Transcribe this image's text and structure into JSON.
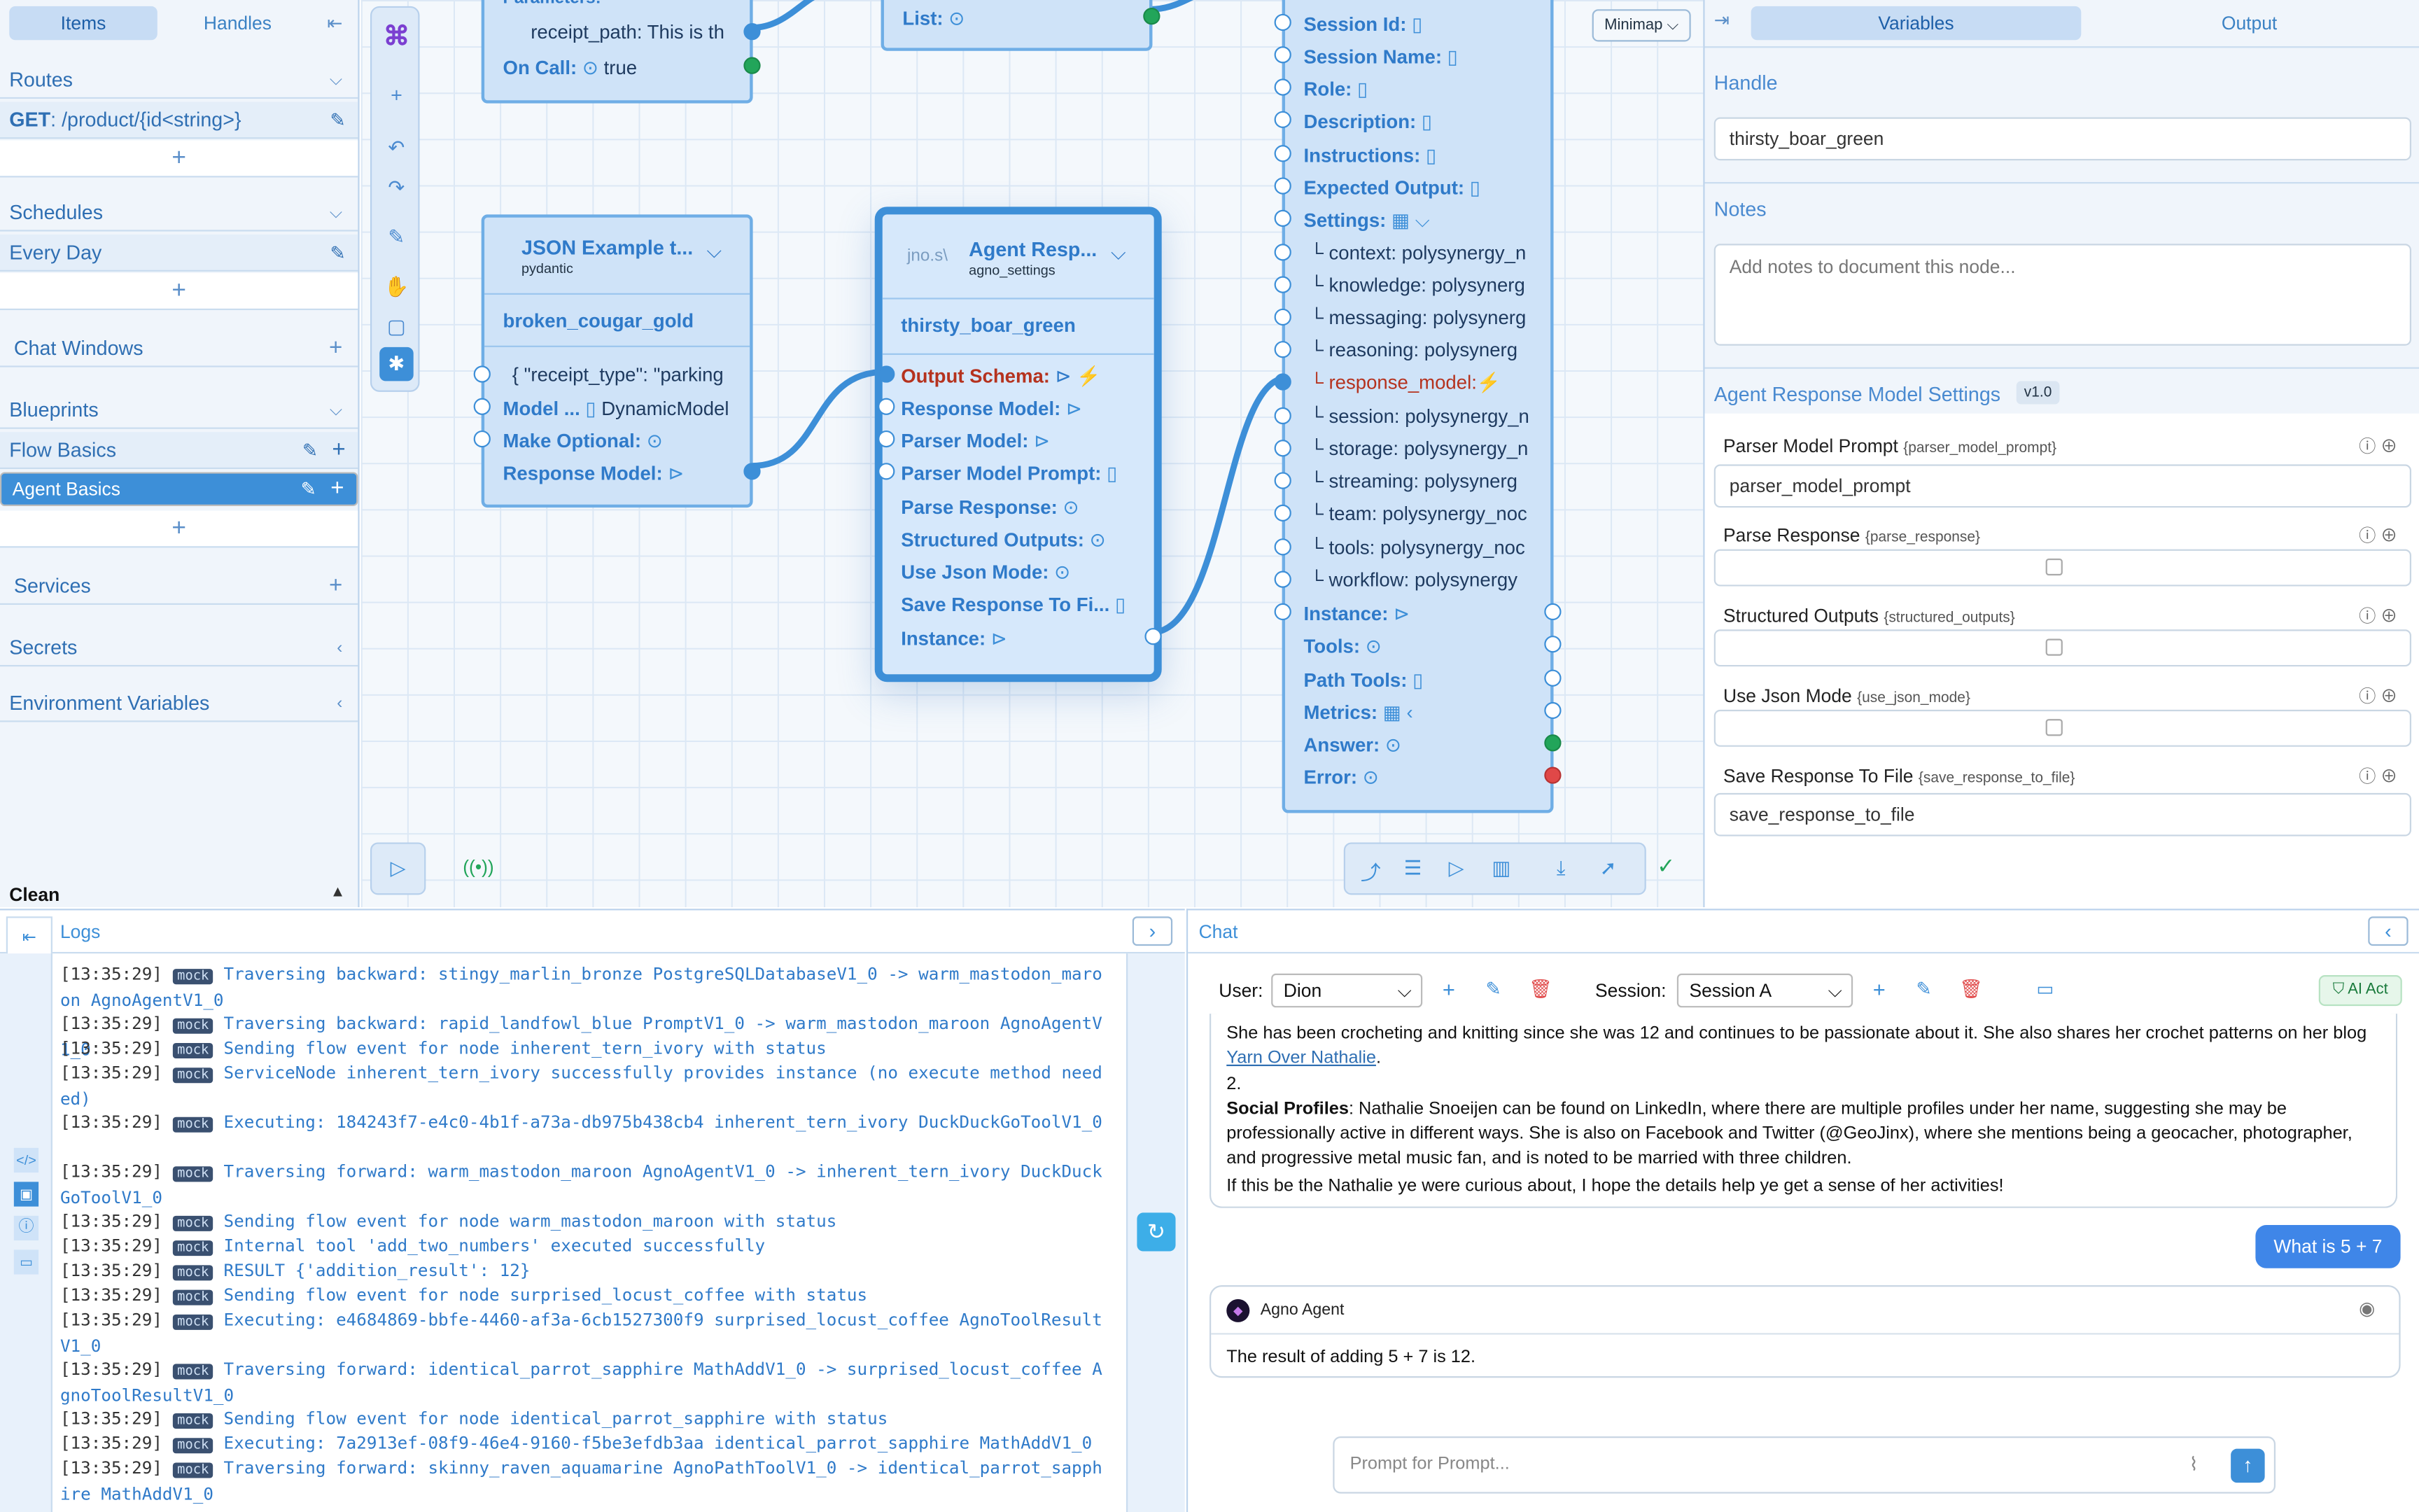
{
  "left": {
    "tabs": [
      "Items",
      "Handles"
    ],
    "routes_label": "Routes",
    "route_method": "GET",
    "route_path": ": /product/{id<string>}",
    "schedules_label": "Schedules",
    "schedule_item": "Every Day",
    "chat_windows_label": "Chat Windows",
    "blueprints_label": "Blueprints",
    "blueprints": [
      "Flow Basics",
      "Agent Basics"
    ],
    "services_label": "Services",
    "secrets_label": "Secrets",
    "env_label": "Environment Variables",
    "clean_label": "Clean"
  },
  "canvas": {
    "minimap_label": "Minimap",
    "node_top_left": {
      "field1": "receipt_path: This is th",
      "oncall_label": "On Call:",
      "oncall_value": "true",
      "params_label": "Parameters:"
    },
    "node_top_mid": {
      "list_label": "List:"
    },
    "node_json": {
      "title": "JSON Example t...",
      "subtitle": "pydantic",
      "handle": "broken_cougar_gold",
      "field1": "{ \"receipt_type\": \"parking",
      "model_label": "Model ...",
      "model_value": "DynamicModel",
      "make_optional": "Make Optional:",
      "response_model": "Response Model:"
    },
    "node_agent_resp": {
      "prefix": "jno.s\\",
      "title": "Agent Resp...",
      "subtitle": "agno_settings",
      "handle": "thirsty_boar_green",
      "fields": [
        "Output Schema:",
        "Response Model:",
        "Parser Model:",
        "Parser Model Prompt:",
        "Parse Response:",
        "Structured Outputs:",
        "Use Json Mode:",
        "Save Response To Fi...",
        "Instance:"
      ]
    },
    "node_agent": {
      "fields": [
        "Session Id:",
        "Session Name:",
        "Role:",
        "Description:",
        "Instructions:",
        "Expected Output:",
        "Settings:"
      ],
      "settings": [
        "context: polysynergy_n",
        "knowledge: polysynerg",
        "messaging: polysynerg",
        "reasoning: polysynerg",
        "response_model:",
        "session: polysynergy_n",
        "storage: polysynergy_n",
        "streaming: polysynerg",
        "team: polysynergy_noc",
        "tools: polysynergy_noc",
        "workflow: polysynergy"
      ],
      "outputs": [
        "Instance:",
        "Tools:",
        "Path Tools:",
        "Metrics:",
        "Answer:",
        "Error:"
      ]
    }
  },
  "right": {
    "tabs": [
      "Variables",
      "Output"
    ],
    "handle_label": "Handle",
    "handle_value": "thirsty_boar_green",
    "notes_label": "Notes",
    "notes_placeholder": "Add notes to document this node...",
    "settings_title": "Agent Response Model Settings",
    "version": "v1.0",
    "params": [
      {
        "label": "Parser Model Prompt",
        "key": "{parser_model_prompt}",
        "value": "parser_model_prompt"
      },
      {
        "label": "Parse Response",
        "key": "{parse_response}"
      },
      {
        "label": "Structured Outputs",
        "key": "{structured_outputs}"
      },
      {
        "label": "Use Json Mode",
        "key": "{use_json_mode}"
      },
      {
        "label": "Save Response To File",
        "key": "{save_response_to_file}",
        "value": "save_response_to_file"
      }
    ]
  },
  "logs": {
    "title": "Logs",
    "badge": "mock",
    "lines": [
      {
        "t": "[13:35:29]",
        "m": "Traversing backward: stingy_marlin_bronze PostgreSQLDatabaseV1_0 -> warm_mastodon_maroon AgnoAgentV1_0"
      },
      {
        "t": "[13:35:29]",
        "m": "Traversing backward: rapid_landfowl_blue PromptV1_0 -> warm_mastodon_maroon AgnoAgentV1_0"
      },
      {
        "t": "[13:35:29]",
        "m": "Sending flow event for node inherent_tern_ivory with status"
      },
      {
        "t": "[13:35:29]",
        "m": "ServiceNode inherent_tern_ivory successfully provides instance (no execute method needed)"
      },
      {
        "t": "[13:35:29]",
        "m": "Executing: 184243f7-e4c0-4b1f-a73a-db975b438cb4 inherent_tern_ivory DuckDuckGoToolV1_0"
      },
      {
        "t": "[13:35:29]",
        "m": "Traversing forward: warm_mastodon_maroon AgnoAgentV1_0 -> inherent_tern_ivory DuckDuckGoToolV1_0"
      },
      {
        "t": "[13:35:29]",
        "m": "Sending flow event for node warm_mastodon_maroon with status"
      },
      {
        "t": "[13:35:29]",
        "m": "Internal tool 'add_two_numbers' executed successfully"
      },
      {
        "t": "[13:35:29]",
        "m": "RESULT {'addition_result': 12}"
      },
      {
        "t": "[13:35:29]",
        "m": "Sending flow event for node surprised_locust_coffee with status"
      },
      {
        "t": "[13:35:29]",
        "m": "Executing: e4684869-bbfe-4460-af3a-6cb1527300f9 surprised_locust_coffee AgnoToolResultV1_0"
      },
      {
        "t": "[13:35:29]",
        "m": "Traversing forward: identical_parrot_sapphire MathAddV1_0 -> surprised_locust_coffee AgnoToolResultV1_0"
      },
      {
        "t": "[13:35:29]",
        "m": "Sending flow event for node identical_parrot_sapphire with status"
      },
      {
        "t": "[13:35:29]",
        "m": "Executing: 7a2913ef-08f9-46e4-9160-f5be3efdb3aa identical_parrot_sapphire MathAddV1_0"
      },
      {
        "t": "[13:35:29]",
        "m": "Traversing forward: skinny_raven_aquamarine AgnoPathToolV1_0 -> identical_parrot_sapphire MathAddV1_0"
      }
    ]
  },
  "chat": {
    "title": "Chat",
    "user_label": "User:",
    "user_value": "Dion",
    "session_label": "Session:",
    "session_value": "Session A",
    "ai_act": "AI Act",
    "msg_p1": "She has been crocheting and knitting since she was 12 and continues to be passionate about it. She also shares her crochet patterns on her blog ",
    "msg_link": "Yarn Over Nathalie",
    "msg_p1_end": ".",
    "msg_num": "2.",
    "msg_bold": "Social Profiles",
    "msg_p2": ": Nathalie Snoeijen can be found on LinkedIn, where there are multiple profiles under her name, suggesting she may be professionally active in different ways. She is also on Facebook and Twitter (@GeoJinx), where she mentions being a geocacher, photographer, and progressive metal music fan, and is noted to be married with three children.",
    "msg_p3": "If this be the Nathalie ye were curious about, I hope the details help ye get a sense of her activities!",
    "user_msg": "What is 5 + 7",
    "agent_name": "Agno Agent",
    "agent_reply": "The result of adding 5 + 7 is 12.",
    "prompt_placeholder": "Prompt for Prompt..."
  }
}
